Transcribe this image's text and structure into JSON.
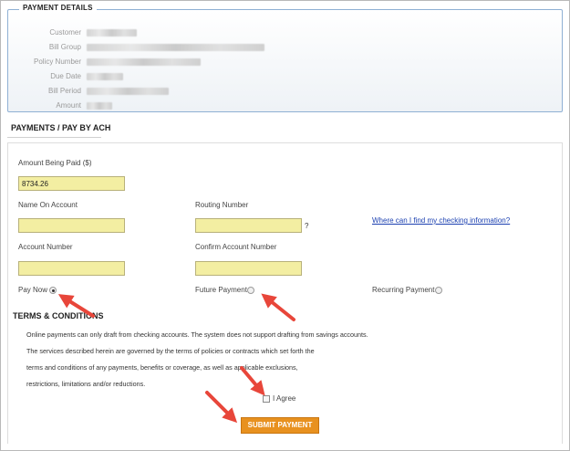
{
  "payment_details": {
    "legend": "PAYMENT DETAILS",
    "rows": [
      {
        "label": "Customer",
        "value_width": 55
      },
      {
        "label": "Bill Group",
        "value_width": 195
      },
      {
        "label": "Policy Number",
        "value_width": 125
      },
      {
        "label": "Due Date",
        "value_width": 40
      },
      {
        "label": "Bill Period",
        "value_width": 90
      },
      {
        "label": "Amount",
        "value_width": 28
      }
    ]
  },
  "ach": {
    "section_title": "PAYMENTS / PAY BY ACH",
    "amount_label": "Amount Being Paid ($)",
    "amount_value": "8734.26",
    "name_label": "Name On Account",
    "name_value": "",
    "routing_label": "Routing Number",
    "routing_value": "",
    "routing_help_mark": "?",
    "help_link": "Where can I find my checking information?",
    "account_label": "Account Number",
    "account_value": "",
    "confirm_label": "Confirm Account Number",
    "confirm_value": "",
    "options": {
      "pay_now": "Pay Now",
      "future_payment": "Future Payment",
      "recurring_payment": "Recurring Payment",
      "selected": "Pay Now"
    }
  },
  "terms": {
    "title": "TERMS & CONDITIONS",
    "lines": [
      "Online payments can only draft from checking accounts. The system does not support drafting from savings accounts.",
      "The services described herein are governed by the terms of policies or contracts which set forth the",
      "terms and conditions of any payments, benefits or coverage, as well as applicable exclusions,",
      "restrictions, limitations and/or reductions."
    ],
    "agree_label": "I Agree",
    "agree_checked": false
  },
  "submit_label": "SUBMIT PAYMENT",
  "colors": {
    "field_bg": "#f3eea2",
    "submit_bg": "#e8911f",
    "link": "#1a3fb0",
    "annotation_arrow": "#e8463a"
  }
}
